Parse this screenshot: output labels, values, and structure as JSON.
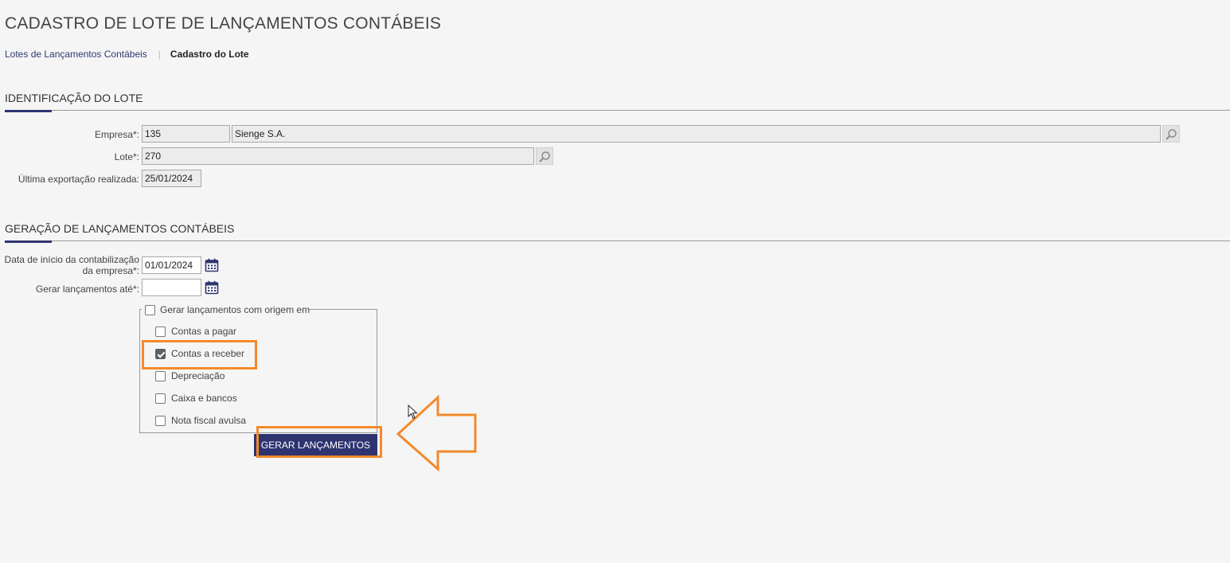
{
  "page": {
    "title": "CADASTRO DE LOTE DE LANÇAMENTOS CONTÁBEIS"
  },
  "breadcrumb": {
    "parent": "Lotes de Lançamentos Contábeis",
    "current": "Cadastro do Lote"
  },
  "identificacao": {
    "section_title": "IDENTIFICAÇÃO DO LOTE",
    "empresa_label": "Empresa*:",
    "empresa_code": "135",
    "empresa_name": "Sienge S.A.",
    "lote_label": "Lote*:",
    "lote_value": "270",
    "ultima_label": "Última exportação realizada:",
    "ultima_value": "25/01/2024"
  },
  "geracao": {
    "section_title": "GERAÇÃO DE LANÇAMENTOS CONTÁBEIS",
    "data_inicio_label_line1": "Data de início da contabilização",
    "data_inicio_label_line2": "da empresa*:",
    "data_inicio_value": "01/01/2024",
    "gerar_ate_label": "Gerar lançamentos até*:",
    "gerar_ate_value": "",
    "origem_legend": "Gerar lançamentos com origem em",
    "origem_options": [
      {
        "label": "Contas a pagar",
        "checked": false
      },
      {
        "label": "Contas a receber",
        "checked": true
      },
      {
        "label": "Depreciação",
        "checked": false
      },
      {
        "label": "Caixa e bancos",
        "checked": false
      },
      {
        "label": "Nota fiscal avulsa",
        "checked": false
      }
    ],
    "generate_button": "GERAR LANÇAMENTOS"
  },
  "icons": {
    "lookup": "magnifier-icon",
    "calendar": "calendar-icon",
    "annotation_arrow": "left-arrow-icon",
    "cursor": "mouse-pointer-icon"
  },
  "colors": {
    "accent": "#2e3470",
    "highlight": "#f28a2a",
    "background": "#f5f5f5"
  }
}
